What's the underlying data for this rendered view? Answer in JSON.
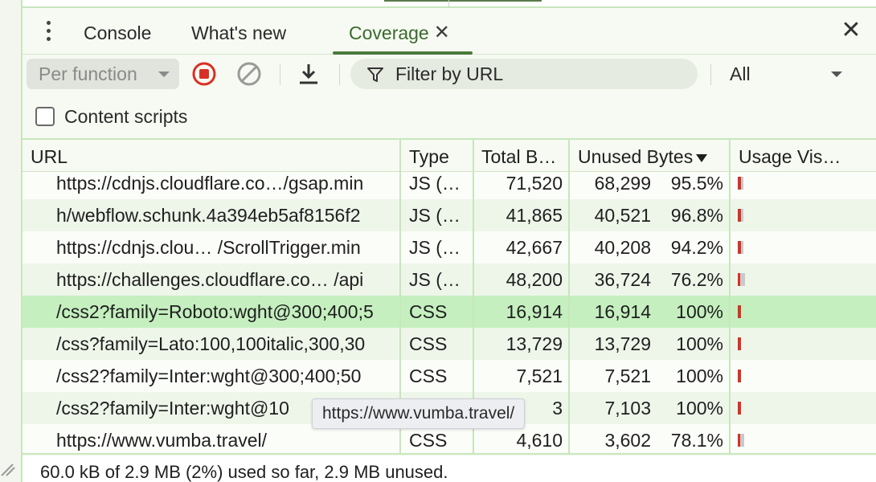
{
  "tabs": [
    {
      "label": "Console",
      "active": false
    },
    {
      "label": "What's new",
      "active": false
    },
    {
      "label": "Coverage",
      "active": true
    }
  ],
  "toolbar": {
    "mode_value": "Per function",
    "filter_placeholder": "Filter by URL",
    "type_value": "All"
  },
  "content_scripts": {
    "label": "Content scripts",
    "checked": false
  },
  "columns": [
    "URL",
    "Type",
    "Total B…",
    "Unused Bytes",
    "Usage Vis…"
  ],
  "rows": [
    {
      "url": "https://cdnjs.cloudflare.co…/gsap.min",
      "type": "JS (…",
      "total": "71,520",
      "unused": "68,299",
      "pct": "95.5%",
      "used_fraction": 0.045
    },
    {
      "url": "h/webflow.schunk.4a394eb5af8156f2",
      "type": "JS (…",
      "total": "41,865",
      "unused": "40,521",
      "pct": "96.8%",
      "used_fraction": 0.032
    },
    {
      "url": "https://cdnjs.clou…  /ScrollTrigger.min",
      "type": "JS (…",
      "total": "42,667",
      "unused": "40,208",
      "pct": "94.2%",
      "used_fraction": 0.058
    },
    {
      "url": "https://challenges.cloudflare.co…  /api",
      "type": "JS (…",
      "total": "48,200",
      "unused": "36,724",
      "pct": "76.2%",
      "used_fraction": 0.238
    },
    {
      "url": "/css2?family=Roboto:wght@300;400;5",
      "type": "CSS",
      "total": "16,914",
      "unused": "16,914",
      "pct": "100%",
      "used_fraction": 0.0
    },
    {
      "url": "/css?family=Lato:100,100italic,300,30",
      "type": "CSS",
      "total": "13,729",
      "unused": "13,729",
      "pct": "100%",
      "used_fraction": 0.0
    },
    {
      "url": "/css2?family=Inter:wght@300;400;50",
      "type": "CSS",
      "total": "7,521",
      "unused": "7,521",
      "pct": "100%",
      "used_fraction": 0.0
    },
    {
      "url": "/css2?family=Inter:wght@10",
      "type": "",
      "total": "3",
      "unused": "7,103",
      "pct": "100%",
      "used_fraction": 0.0
    },
    {
      "url": "https://www.vumba.travel/",
      "type": "CSS",
      "total": "4,610",
      "unused": "3,602",
      "pct": "78.1%",
      "used_fraction": 0.219
    }
  ],
  "selected_row": 4,
  "tooltip": "https://www.vumba.travel/",
  "status": "60.0 kB of 2.9 MB (2%) used so far, 2.9 MB unused.",
  "colors": {
    "accent": "#3b6a2e",
    "used_bar": "#d93025",
    "unused_bar": "#c9c9c9",
    "selected_row": "#c5efbf"
  }
}
